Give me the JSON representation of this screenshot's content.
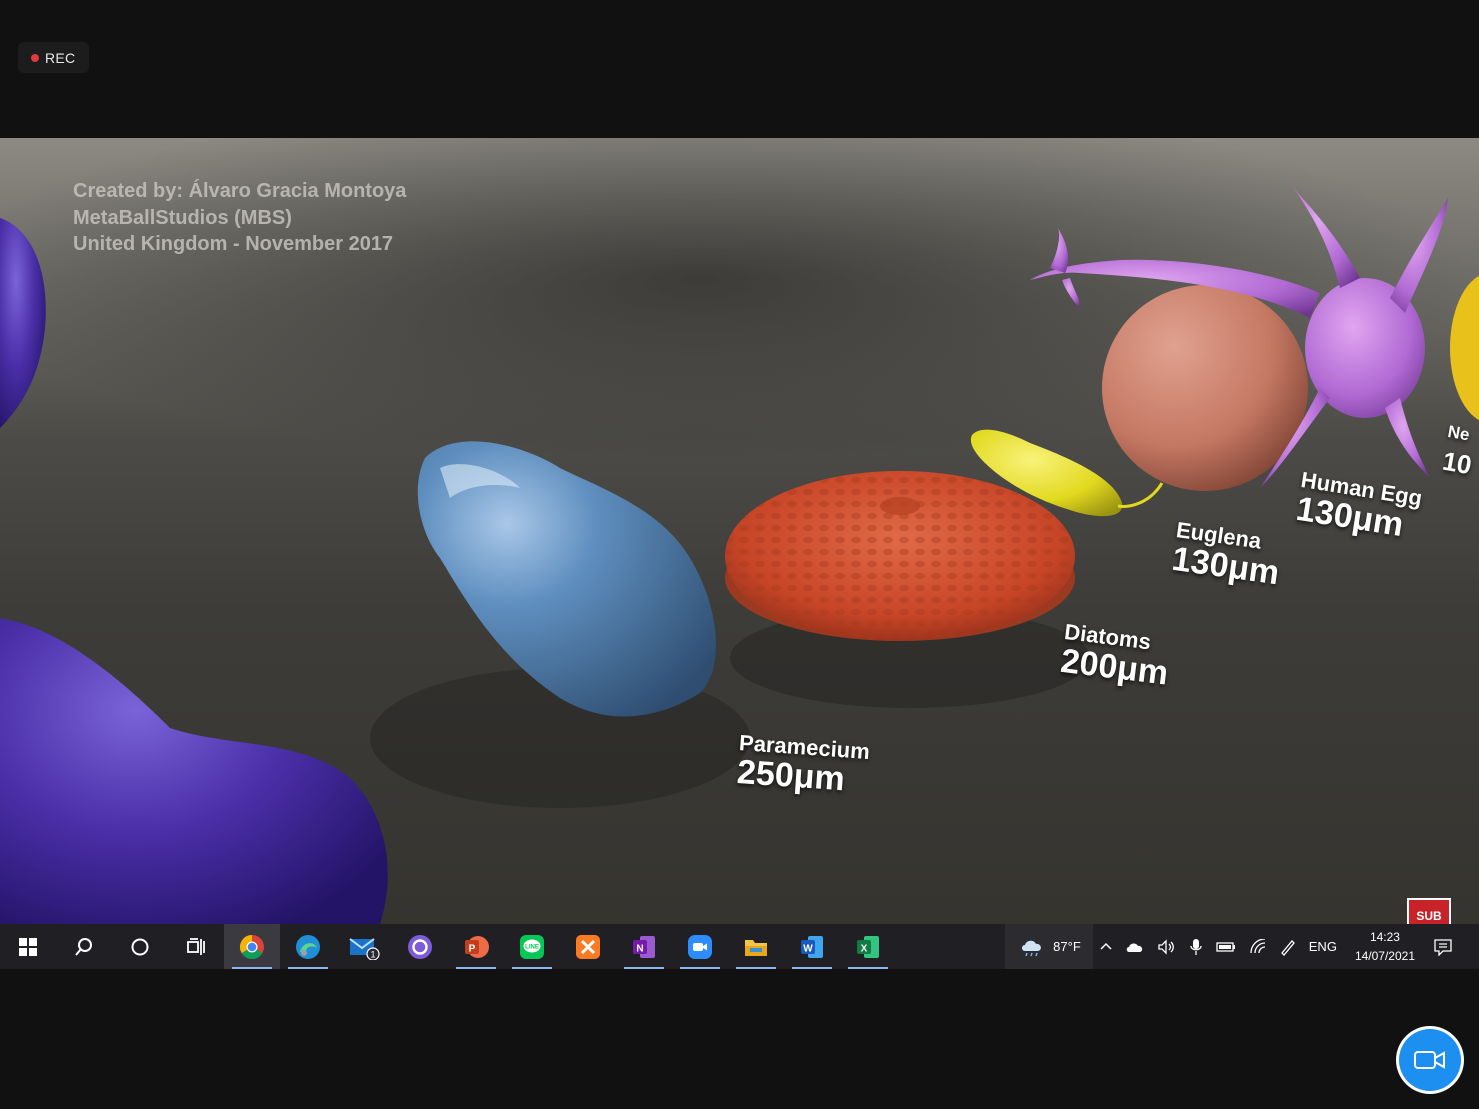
{
  "recording": {
    "label": "REC"
  },
  "video": {
    "credits": [
      "Created by: Álvaro Gracia Montoya",
      "MetaBallStudios (MBS)",
      "United Kingdom - November 2017"
    ],
    "labels": [
      {
        "name": "Paramecium",
        "size": "250μm"
      },
      {
        "name": "Diatoms",
        "size": "200μm"
      },
      {
        "name": "Euglena",
        "size": "130μm"
      },
      {
        "name": "Human Egg",
        "size": "130μm"
      },
      {
        "name": "Ne",
        "size": "10"
      }
    ],
    "subscribe_badge": "SUB"
  },
  "taskbar": {
    "apps": [
      {
        "name": "start",
        "icon": "windows-logo-icon"
      },
      {
        "name": "search",
        "icon": "search-icon"
      },
      {
        "name": "cortana",
        "icon": "cortana-icon"
      },
      {
        "name": "task-view",
        "icon": "task-view-icon"
      },
      {
        "name": "chrome",
        "icon": "chrome-icon",
        "active": true,
        "running": true
      },
      {
        "name": "edge",
        "icon": "edge-icon",
        "running": true
      },
      {
        "name": "mail",
        "icon": "mail-icon",
        "badge": "1"
      },
      {
        "name": "cortana-app",
        "icon": "circle-app-icon"
      },
      {
        "name": "powerpoint",
        "icon": "powerpoint-icon",
        "running": true
      },
      {
        "name": "line",
        "icon": "line-icon",
        "running": true
      },
      {
        "name": "xampp",
        "icon": "xampp-icon"
      },
      {
        "name": "onenote",
        "icon": "onenote-icon",
        "running": true
      },
      {
        "name": "zoom",
        "icon": "zoom-icon",
        "running": true
      },
      {
        "name": "file-explorer",
        "icon": "folder-icon",
        "running": true
      },
      {
        "name": "word",
        "icon": "word-icon",
        "running": true
      },
      {
        "name": "excel",
        "icon": "excel-icon",
        "running": true
      }
    ],
    "weather": {
      "temperature": "87°F",
      "icon": "cloud-rain-icon"
    },
    "tray": {
      "language": "ENG",
      "time": "14:23",
      "date": "14/07/2021"
    }
  },
  "colors": {
    "taskbar": "#202024",
    "accent": "#1d8ff0",
    "rec": "#e0393e"
  }
}
